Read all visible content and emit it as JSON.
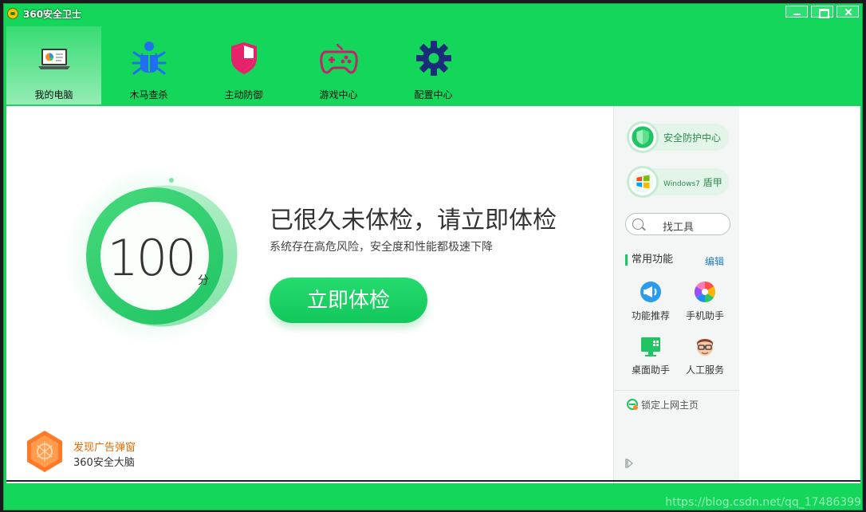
{
  "window": {
    "title": "360安全卫士",
    "controls": {
      "minimize": "minimize",
      "maximize": "maximize",
      "close": "close"
    }
  },
  "nav": {
    "tabs": [
      {
        "label": "我的电脑",
        "icon": "computer-icon",
        "active": true
      },
      {
        "label": "木马查杀",
        "icon": "bug-icon"
      },
      {
        "label": "主动防御",
        "icon": "shield-icon"
      },
      {
        "label": "游戏中心",
        "icon": "gamepad-icon"
      },
      {
        "label": "配置中心",
        "icon": "gear-icon"
      }
    ]
  },
  "main": {
    "score": "100",
    "score_unit": "分",
    "headline": "已很久未体检，请立即体检",
    "subline": "系统存在高危风险，安全度和性能都极速下降",
    "check_button": "立即体检"
  },
  "ad": {
    "title": "发现广告弹窗",
    "subtitle": "360安全大脑"
  },
  "sidebar": {
    "security_center": "安全防护中心",
    "win7_shield_prefix": "Windows7",
    "win7_shield_suffix": " 盾甲",
    "search_placeholder": "找工具",
    "common_title": "常用功能",
    "edit": "编辑",
    "tools": [
      {
        "label": "功能推荐",
        "icon": "recommend-icon"
      },
      {
        "label": "手机助手",
        "icon": "phone-assistant-icon"
      },
      {
        "label": "桌面助手",
        "icon": "desktop-assistant-icon"
      },
      {
        "label": "人工服务",
        "icon": "human-service-icon"
      }
    ],
    "lock_homepage": "锁定上网主页"
  },
  "watermark": "https://blog.csdn.net/qq_17486399",
  "colors": {
    "brand_green": "#14d65b",
    "button_green": "#1fc463",
    "link_blue": "#1f7ad1",
    "ad_orange": "#e86a00"
  }
}
